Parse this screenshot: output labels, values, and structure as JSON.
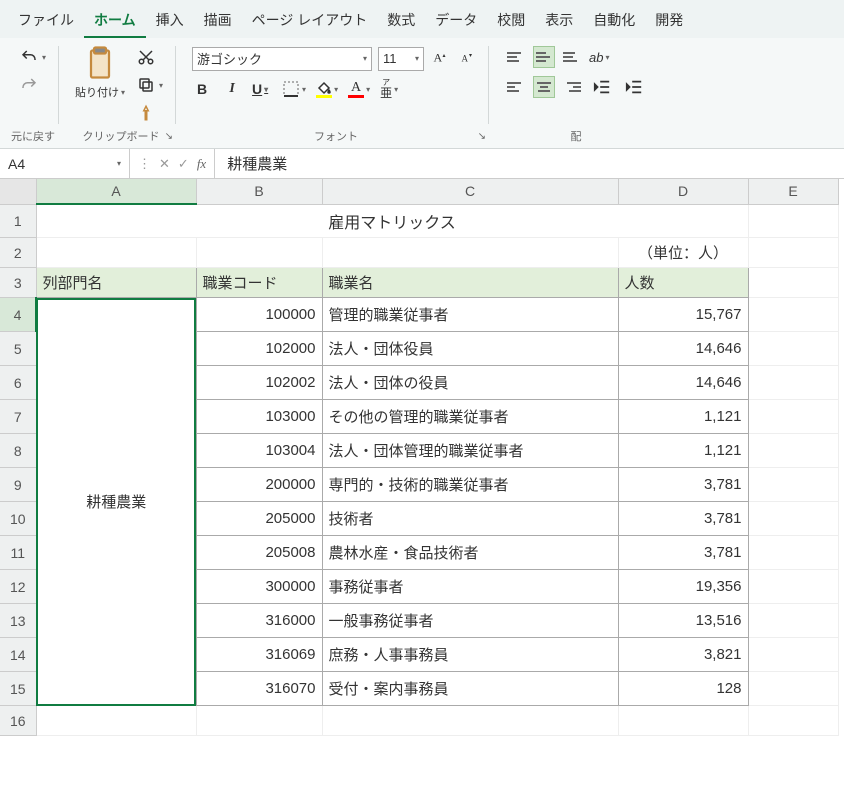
{
  "menu": {
    "file": "ファイル",
    "home": "ホーム",
    "insert": "挿入",
    "draw": "描画",
    "pagelayout": "ページ レイアウト",
    "formulas": "数式",
    "data": "データ",
    "review": "校閲",
    "view": "表示",
    "automate": "自動化",
    "developer": "開発"
  },
  "ribbon": {
    "group_undo": "元に戻す",
    "group_clipboard": "クリップボード",
    "group_font": "フォント",
    "group_align_partial": "配",
    "paste_label": "貼り付け",
    "font_name": "游ゴシック",
    "font_size": "11",
    "bold": "B",
    "italic": "I",
    "underline": "U",
    "ruby": "ア亜"
  },
  "namebox": "A4",
  "formula_value": "耕種農業",
  "columns": [
    "A",
    "B",
    "C",
    "D",
    "E"
  ],
  "row_numbers": [
    1,
    2,
    3,
    4,
    5,
    6,
    7,
    8,
    9,
    10,
    11,
    12,
    13,
    14,
    15,
    16
  ],
  "sheet": {
    "title": "雇用マトリックス",
    "unit": "（単位：人）",
    "headers": {
      "a": "列部門名",
      "b": "職業コード",
      "c": "職業名",
      "d": "人数"
    },
    "merged_a": "耕種農業",
    "rows": [
      {
        "code": "100000",
        "name": "管理的職業従事者",
        "count": "15,767"
      },
      {
        "code": "102000",
        "name": "法人・団体役員",
        "count": "14,646"
      },
      {
        "code": "102002",
        "name": "法人・団体の役員",
        "count": "14,646"
      },
      {
        "code": "103000",
        "name": "その他の管理的職業従事者",
        "count": "1,121"
      },
      {
        "code": "103004",
        "name": "法人・団体管理的職業従事者",
        "count": "1,121"
      },
      {
        "code": "200000",
        "name": "専門的・技術的職業従事者",
        "count": "3,781"
      },
      {
        "code": "205000",
        "name": "技術者",
        "count": "3,781"
      },
      {
        "code": "205008",
        "name": "農林水産・食品技術者",
        "count": "3,781"
      },
      {
        "code": "300000",
        "name": "事務従事者",
        "count": "19,356"
      },
      {
        "code": "316000",
        "name": "一般事務従事者",
        "count": "13,516"
      },
      {
        "code": "316069",
        "name": "庶務・人事事務員",
        "count": "3,821"
      },
      {
        "code": "316070",
        "name": "受付・案内事務員",
        "count": "128"
      }
    ]
  },
  "chart_data": {
    "type": "table",
    "title": "雇用マトリックス",
    "unit": "人",
    "sector": "耕種農業",
    "columns": [
      "職業コード",
      "職業名",
      "人数"
    ],
    "rows": [
      [
        100000,
        "管理的職業従事者",
        15767
      ],
      [
        102000,
        "法人・団体役員",
        14646
      ],
      [
        102002,
        "法人・団体の役員",
        14646
      ],
      [
        103000,
        "その他の管理的職業従事者",
        1121
      ],
      [
        103004,
        "法人・団体管理的職業従事者",
        1121
      ],
      [
        200000,
        "専門的・技術的職業従事者",
        3781
      ],
      [
        205000,
        "技術者",
        3781
      ],
      [
        205008,
        "農林水産・食品技術者",
        3781
      ],
      [
        300000,
        "事務従事者",
        19356
      ],
      [
        316000,
        "一般事務従事者",
        13516
      ],
      [
        316069,
        "庶務・人事事務員",
        3821
      ],
      [
        316070,
        "受付・案内事務員",
        128
      ]
    ]
  }
}
